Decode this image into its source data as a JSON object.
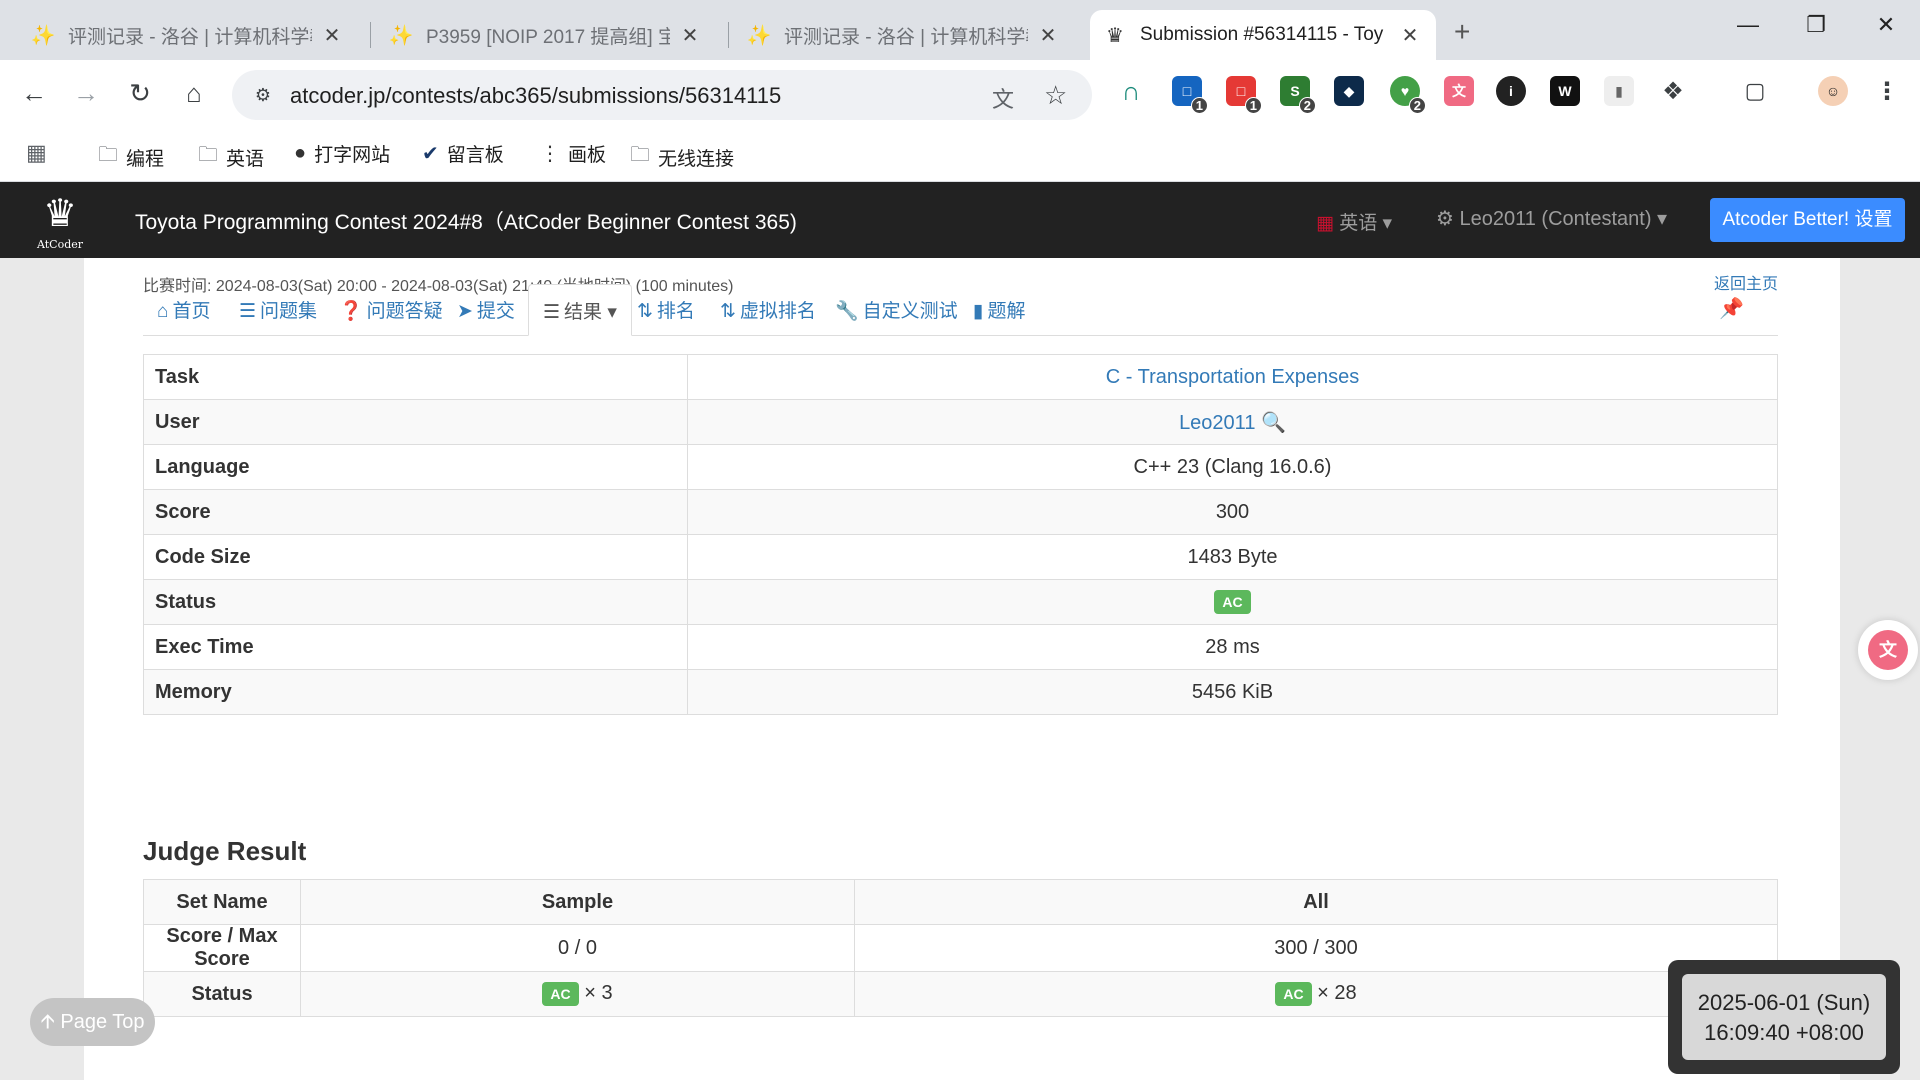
{
  "browser": {
    "tabs": [
      {
        "label": "评测记录 - 洛谷 | 计算机科学教",
        "icon": "luogu-icon"
      },
      {
        "label": "P3959 [NOIP 2017 提高组] 宝",
        "icon": "luogu-icon"
      },
      {
        "label": "评测记录 - 洛谷 | 计算机科学教",
        "icon": "luogu-icon"
      },
      {
        "label": "Submission #56314115 - Toy",
        "icon": "atcoder-icon"
      }
    ],
    "new_tab": "+",
    "url": "atcoder.jp/contests/abc365/submissions/56314115",
    "extension_badges": [
      "1",
      "1",
      "2",
      "2"
    ],
    "bookmarks": [
      "编程",
      "英语",
      "打字网站",
      "留言板",
      "画板",
      "无线连接"
    ]
  },
  "atcoder": {
    "contest_title": "Toyota Programming Contest 2024#8（AtCoder Beginner Contest 365)",
    "lang_menu": "英语",
    "user_menu": "Leo2011 (Contestant)",
    "better_button": "Atcoder Better! 设置",
    "logo_text": "AtCoder",
    "contest_time": "比赛时间: 2024-08-03(Sat) 20:00 - 2024-08-03(Sat) 21:40 (当地时间) (100 minutes)",
    "back_home": "返回主页",
    "nav": [
      "首页",
      "问题集",
      "问题答疑",
      "提交",
      "结果",
      "排名",
      "虚拟排名",
      "自定义测试",
      "题解"
    ]
  },
  "submission": {
    "rows": [
      {
        "key": "Task",
        "value": "C - Transportation Expenses"
      },
      {
        "key": "User",
        "value": "Leo2011"
      },
      {
        "key": "Language",
        "value": "C++ 23 (Clang 16.0.6)"
      },
      {
        "key": "Score",
        "value": "300"
      },
      {
        "key": "Code Size",
        "value": "1483 Byte"
      },
      {
        "key": "Status",
        "value": "AC"
      },
      {
        "key": "Exec Time",
        "value": "28 ms"
      },
      {
        "key": "Memory",
        "value": "5456 KiB"
      }
    ]
  },
  "judge": {
    "title": "Judge Result",
    "headers": [
      "Set Name",
      "Sample",
      "All"
    ],
    "score_label": "Score / Max Score",
    "score_sample": "0 / 0",
    "score_all": "300 / 300",
    "status_label": "Status",
    "status_badge": "AC",
    "sample_count": "× 3",
    "all_count": "× 28"
  },
  "page_top": "Page Top",
  "clock": {
    "date": "2025-06-01 (Sun)",
    "time": "16:09:40 +08:00"
  },
  "colors": {
    "atcoder_nav": "#222222",
    "ac_badge": "#5cb85c",
    "link": "#337ab7",
    "better": "#3b8cff"
  }
}
